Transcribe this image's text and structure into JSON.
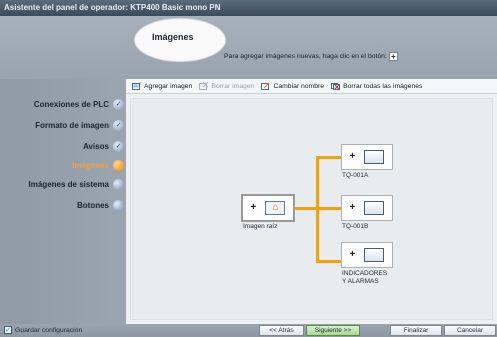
{
  "window": {
    "title": "Asistente del panel de operador: KTP400 Basic mono PN"
  },
  "header": {
    "page_title": "Imágenes",
    "hint_text": "Para agregar imágenes nuevas, haga clic en el botón:",
    "hint_button_label": "+"
  },
  "sidebar": {
    "items": [
      {
        "label": "Conexiones de PLC",
        "state": "done",
        "status_glyph": "✓"
      },
      {
        "label": "Formato de imagen",
        "state": "done",
        "status_glyph": "✓"
      },
      {
        "label": "Avisos",
        "state": "done",
        "status_glyph": "✓"
      },
      {
        "label": "Imágenes",
        "state": "active",
        "status_glyph": ""
      },
      {
        "label": "Imágenes de sistema",
        "state": "pending",
        "status_glyph": ""
      },
      {
        "label": "Botones",
        "state": "pending",
        "status_glyph": ""
      }
    ],
    "active_color": "#f08a00"
  },
  "toolbar": {
    "add_label": "Agregar imagen",
    "delete_label": "Borrar imagen",
    "rename_label": "Cambiar nombre",
    "delete_all_label": "Borrar todas las imágenes"
  },
  "tree": {
    "root": {
      "label": "Imagen raíz",
      "plus": "+",
      "icon": "home-icon"
    },
    "children": [
      {
        "label": "TQ-001A",
        "plus": "+"
      },
      {
        "label": "TQ-001B",
        "plus": "+"
      },
      {
        "label": "INDICADORES\nY ALARMAS",
        "plus": "+"
      }
    ],
    "connector_color": "#f5a20a"
  },
  "footer": {
    "save_config_label": "Guardar configuración",
    "save_config_checked": true,
    "back_label": "<< Atrás",
    "next_label": "Siguiente >>",
    "finish_label": "Finalizar",
    "cancel_label": "Cancelar"
  }
}
